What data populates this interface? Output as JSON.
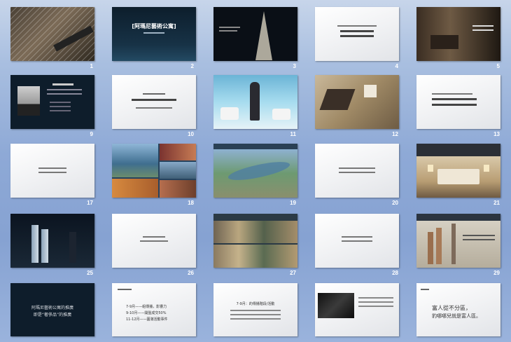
{
  "slide_numbers": {
    "s1": "1",
    "s2": "2",
    "s3": "3",
    "s4": "4",
    "s5": "5",
    "s9": "9",
    "s10": "10",
    "s11": "11",
    "s12": "12",
    "s13": "13",
    "s17": "17",
    "s18": "18",
    "s19": "19",
    "s20": "20",
    "s21": "21",
    "s25": "25",
    "s26": "26",
    "s27": "27",
    "s28": "28",
    "s29": "29"
  },
  "slides": {
    "s2": {
      "title": "[阿瑪尼藝術公寓]"
    },
    "s30": {
      "line1": "阿瑪尼藝術公寓的推廣",
      "line2": "即是“奢侈品”的推廣"
    },
    "s31": {
      "items": [
        "7-9月——組傳播，影響力",
        "9-10月——開盤成交50%",
        "11-12月——圓滿活動事件"
      ]
    },
    "s32": {
      "title": "7-9月：的傳播階段/活動"
    },
    "s34": {
      "line1": "富人從不分區，",
      "line2": "豹哪哪兒就是富人區。"
    }
  },
  "colors": {
    "background": "#8ea9d6",
    "dark_slide": "#0e1d2b",
    "slide_number": "#ffffff"
  }
}
